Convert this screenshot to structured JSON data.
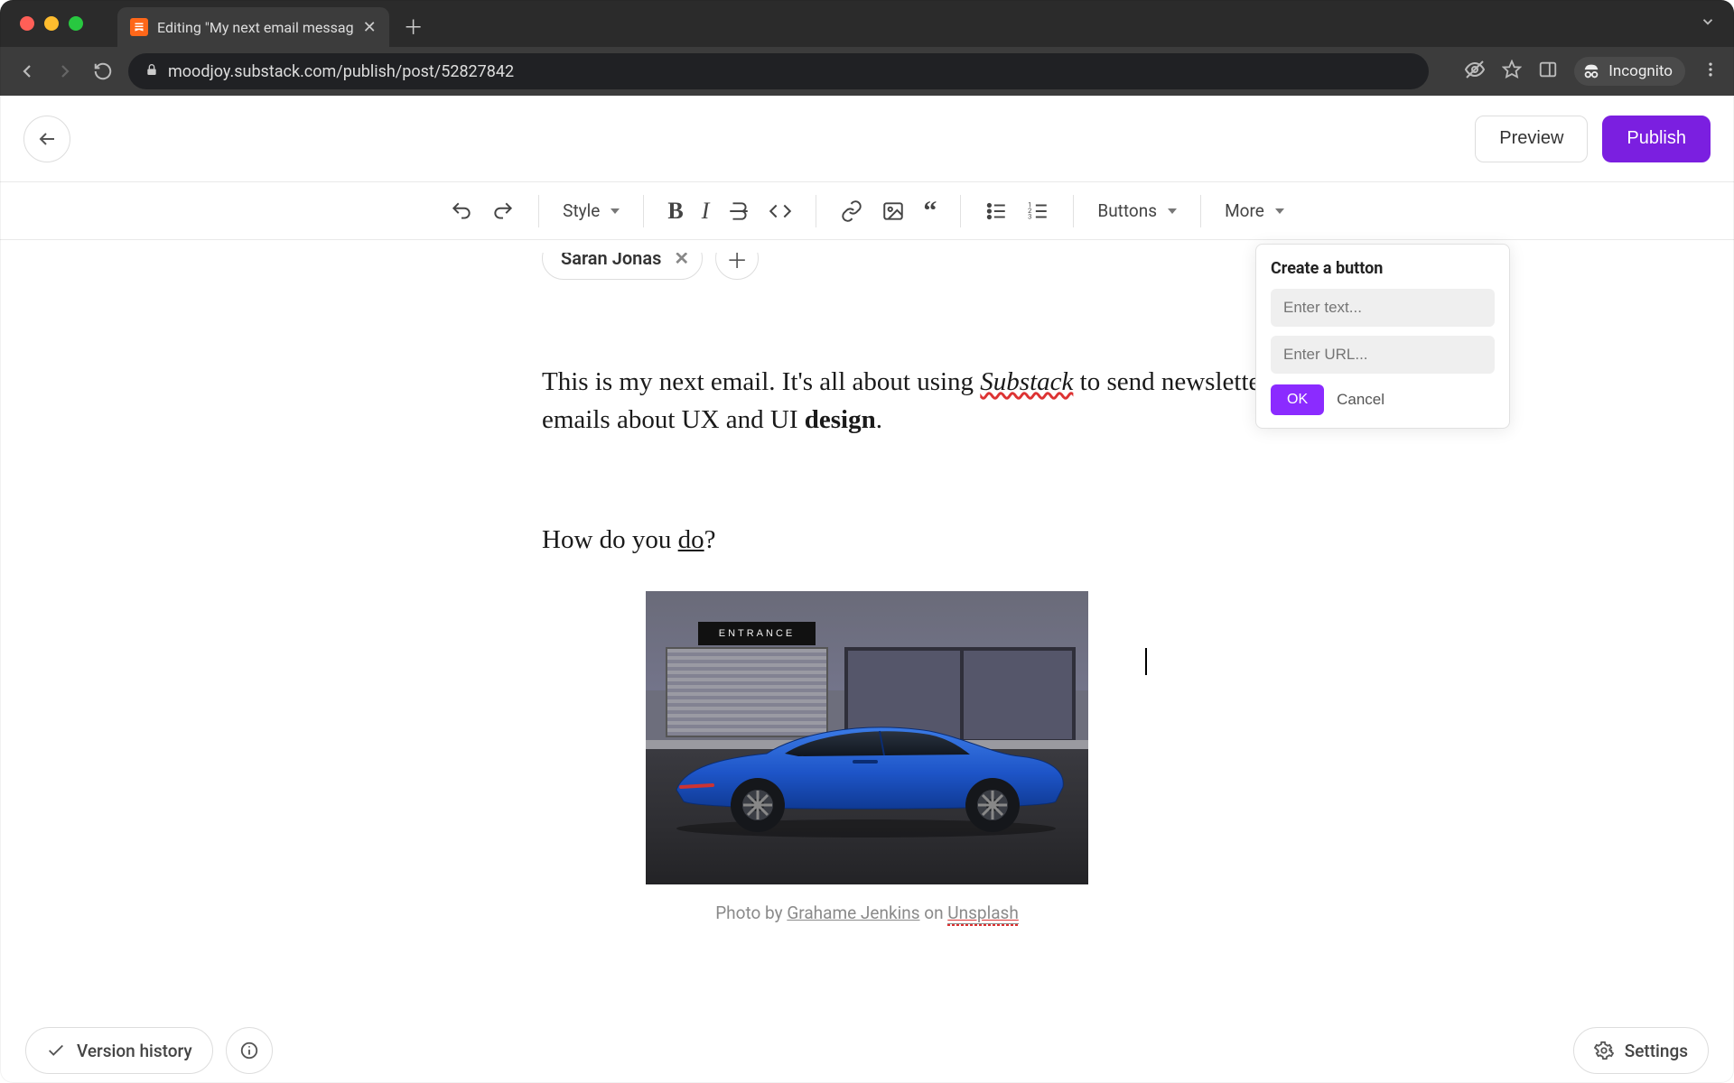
{
  "browser": {
    "tab_title": "Editing \"My next email messag",
    "url": "moodjoy.substack.com/publish/post/52827842",
    "incognito_label": "Incognito"
  },
  "header": {
    "preview_label": "Preview",
    "publish_label": "Publish"
  },
  "toolbar": {
    "style_label": "Style",
    "buttons_label": "Buttons",
    "more_label": "More"
  },
  "byline": {
    "author": "Saran Jonas"
  },
  "content": {
    "para1_a": "This is my next email. It's all about using ",
    "para1_substack": "Substack",
    "para1_b": " to send newsletter emails about UX and UI ",
    "para1_bold": "design",
    "para1_c": ".",
    "para2_a": "How do you ",
    "para2_u": "do",
    "para2_b": "?",
    "caption_a": "Photo by ",
    "caption_author": "Grahame Jenkins",
    "caption_b": " on ",
    "caption_src": "Unsplash",
    "entrance_sign": "ENTRANCE"
  },
  "popover": {
    "title": "Create a button",
    "text_placeholder": "Enter text...",
    "url_placeholder": "Enter URL...",
    "ok_label": "OK",
    "cancel_label": "Cancel"
  },
  "footer": {
    "version_history": "Version history",
    "settings": "Settings"
  }
}
